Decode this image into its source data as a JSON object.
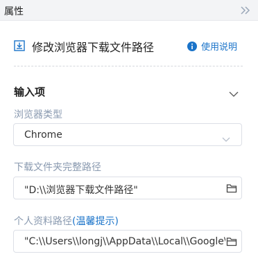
{
  "panel": {
    "title": "属性",
    "collapse_icon": "double-chevron-right-icon"
  },
  "action": {
    "icon": "download-box-icon",
    "title": "修改浏览器下载文件路径",
    "help_icon": "info-icon",
    "help_label": "使用说明"
  },
  "section": {
    "title": "输入项",
    "chevron_icon": "chevron-down-icon"
  },
  "fields": {
    "browser_type": {
      "label": "浏览器类型",
      "value": "Chrome"
    },
    "download_folder": {
      "label": "下载文件夹完整路径",
      "value": "\"D:\\\\浏览器下载文件路径\"",
      "icon": "folder-icon"
    },
    "profile_path": {
      "label": "个人资料路径",
      "hint": "(温馨提示)",
      "value": "\"C:\\\\Users\\\\longj\\\\AppData\\\\Local\\\\Google\\\\",
      "icon": "folder-icon"
    }
  },
  "colors": {
    "accent": "#1a73c9",
    "label": "#8a9ab0",
    "border": "#dcdfe6",
    "header_bg": "#f3f4f6"
  }
}
